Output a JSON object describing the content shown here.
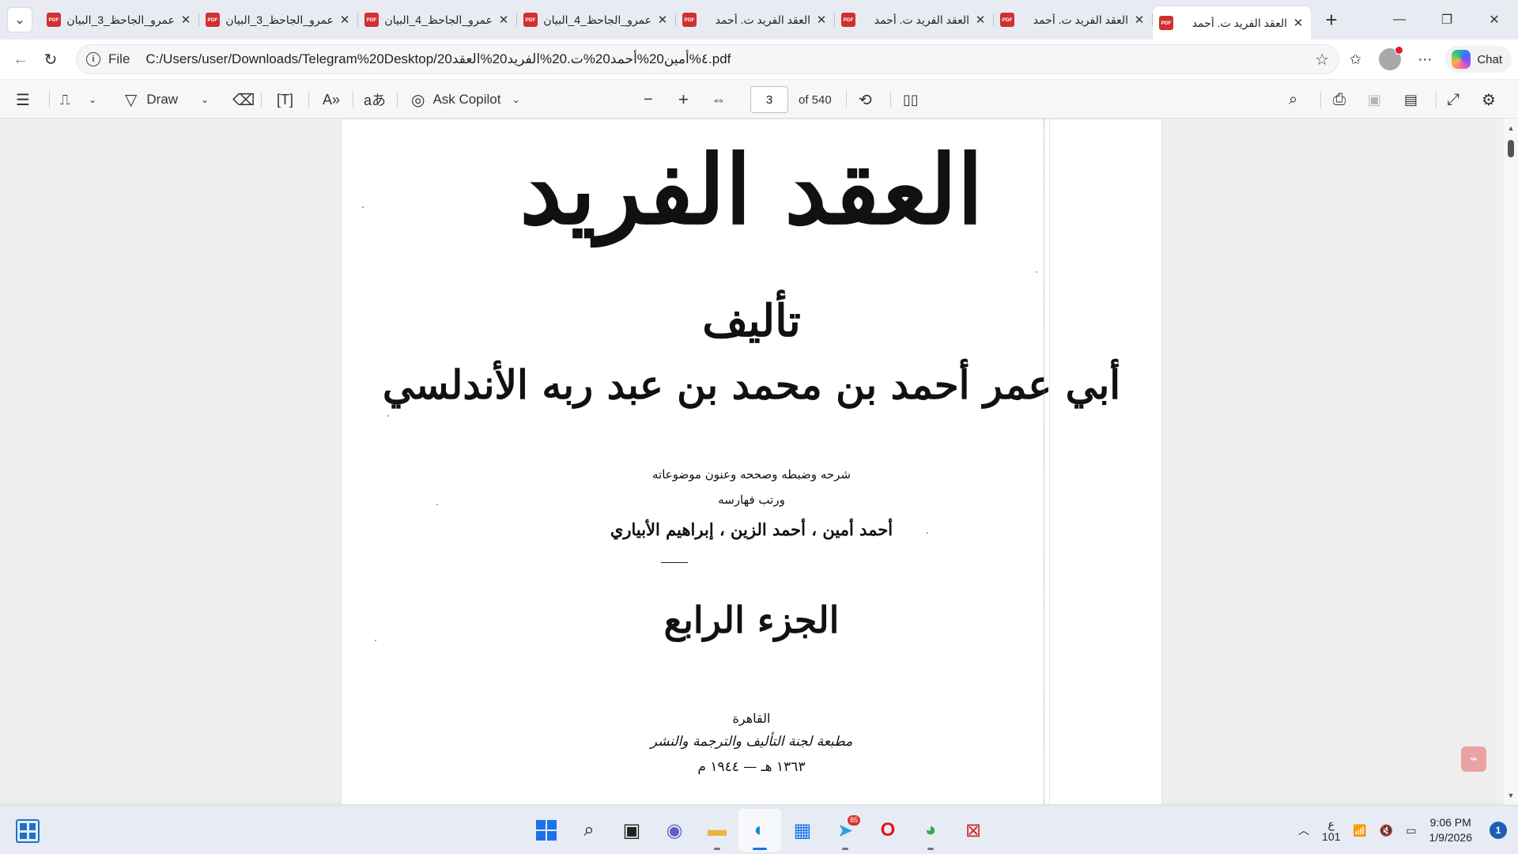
{
  "tabs": [
    {
      "title": "عمرو_الجاحظ_3_البيان",
      "active": false
    },
    {
      "title": "عمرو_الجاحظ_3_البيان",
      "active": false
    },
    {
      "title": "عمرو_الجاحظ_4_البيان",
      "active": false
    },
    {
      "title": "عمرو_الجاحظ_4_البيان",
      "active": false
    },
    {
      "title": "العقد الفريد ت. أحمد",
      "active": false
    },
    {
      "title": "العقد الفريد ت. أحمد",
      "active": false
    },
    {
      "title": "العقد الفريد ت. أحمد",
      "active": false
    },
    {
      "title": "العقد الفريد ت. أحمد",
      "active": true
    }
  ],
  "addressbar": {
    "scheme_label": "File",
    "url": "C:/Users/user/Downloads/Telegram%20Desktop/20٤%أمين20%أحمد20%ت.20%الفريد20%العقد.pdf",
    "chat_label": "Chat"
  },
  "toolbar": {
    "draw_label": "Draw",
    "copilot_label": "Ask Copilot",
    "page_number": "3",
    "page_total": "of 540"
  },
  "pdf_page": {
    "title": "العقد الفريد",
    "authored_by": "تأليف",
    "author": "أبي عمر أحمد بن محمد بن عبد ربه الأندلسي",
    "editors_line1": "شرحه وضبطه وصححه وعنون موضوعاته",
    "editors_line2": "ورتب فهارسه",
    "editors_names": "أحمد أمين ، أحمد الزين ، إبراهيم الأبياري",
    "volume": "الجزء الرابع",
    "place": "القاهرة",
    "press": "مطبعة لجنة التأليف والترجمة والنشر",
    "date": "١٣٦٣ هـ — ١٩٤٤ م"
  },
  "taskbar": {
    "telegram_badge": "85",
    "lang_top": "ع",
    "lang_bottom": "101",
    "time": "9:06 PM",
    "date": "1/9/2026",
    "notifications": "1"
  },
  "colors": {
    "pdf_icon": "#d32f2f",
    "accent": "#1a73e8",
    "tabstrip_bg": "#e8ecf2",
    "viewer_bg": "#efefef"
  }
}
